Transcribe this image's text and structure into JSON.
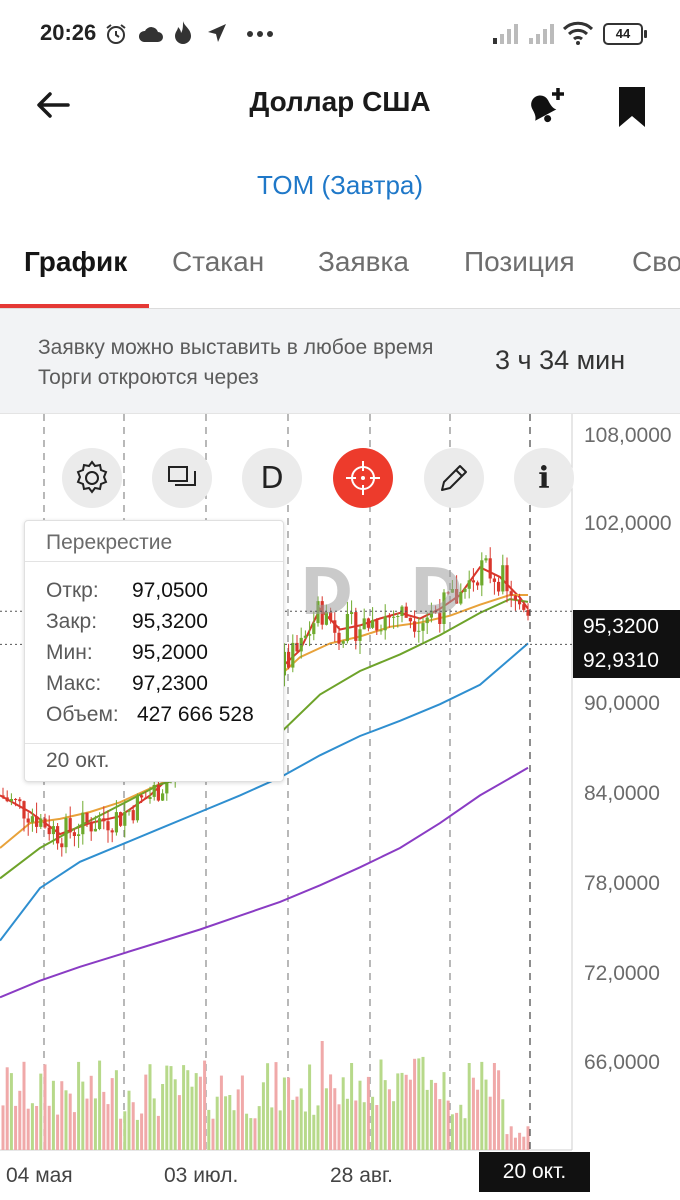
{
  "status_bar": {
    "time": "20:26",
    "battery": "44",
    "icons": [
      "alarm-icon",
      "cloud-icon",
      "fire-icon",
      "location-arrow-icon",
      "more-dots-icon",
      "signal-icon",
      "signal-icon",
      "wifi-icon",
      "battery-icon"
    ]
  },
  "header": {
    "title": "Доллар США",
    "subtitle": "TOM (Завтра)",
    "icons": [
      "back-arrow-icon",
      "bell-plus-icon",
      "bookmark-icon"
    ]
  },
  "tabs": [
    {
      "label": "График",
      "active": true
    },
    {
      "label": "Стакан",
      "active": false
    },
    {
      "label": "Заявка",
      "active": false
    },
    {
      "label": "Позиция",
      "active": false
    },
    {
      "label": "Сво",
      "active": false
    }
  ],
  "notice": {
    "text": "Заявку можно выставить в любое время Торги откроются через",
    "timer": "3 ч 34 мин"
  },
  "toolbar": {
    "buttons": [
      "gear-icon",
      "windows-icon",
      "d-letter-icon",
      "crosshair-icon",
      "pencil-icon",
      "info-icon"
    ],
    "active": "crosshair-icon",
    "d_label": "D",
    "i_label": "i"
  },
  "crosshair_panel": {
    "title": "Перекрестие",
    "rows": [
      {
        "label": "Откр:",
        "value": "97,0500"
      },
      {
        "label": "Закр:",
        "value": "95,3200"
      },
      {
        "label": "Мин:",
        "value": "95,2000"
      },
      {
        "label": "Макс:",
        "value": "97,2300"
      },
      {
        "label": "Объем:",
        "value": "427 666 528"
      }
    ],
    "date": "20 окт."
  },
  "colors": {
    "accent": "#e53935",
    "link": "#1f78c8",
    "candle_up": "#6eaa2c",
    "candle_down": "#d9362c",
    "ma_fast": "#d9362c",
    "ma_orange": "#e8a23a",
    "ma_green": "#6ea32a",
    "ma_blue": "#2f8fd0",
    "ma_purple": "#8a3cc4"
  },
  "chart_data": {
    "type": "candlestick",
    "y_ticks": [
      "108,0000",
      "102,0000",
      "90,0000",
      "84,0000",
      "78,0000",
      "72,0000",
      "66,0000"
    ],
    "ylim": [
      62.5,
      108
    ],
    "x_ticks": [
      "04 мая",
      "03 июл.",
      "28 авг."
    ],
    "selected_date": "20 окт.",
    "price_tags": [
      {
        "label": "95,3200",
        "value": 95.32
      },
      {
        "label": "92,9310",
        "value": 92.931
      }
    ],
    "moving_averages": {
      "red": [
        [
          0,
          82.0
        ],
        [
          30,
          80.8
        ],
        [
          60,
          79.2
        ],
        [
          90,
          80.0
        ],
        [
          120,
          80.5
        ],
        [
          150,
          82.0
        ],
        [
          180,
          84.0
        ],
        [
          210,
          86.0
        ],
        [
          240,
          88.5
        ],
        [
          270,
          90.5
        ],
        [
          300,
          92.5
        ],
        [
          320,
          95.5
        ],
        [
          340,
          94.0
        ],
        [
          360,
          94.3
        ],
        [
          380,
          94.8
        ],
        [
          400,
          95.2
        ],
        [
          420,
          94.8
        ],
        [
          440,
          95.5
        ],
        [
          460,
          96.5
        ],
        [
          480,
          98.5
        ],
        [
          500,
          97.8
        ],
        [
          520,
          96.3
        ],
        [
          528,
          95.5
        ]
      ],
      "orange": [
        [
          0,
          78.2
        ],
        [
          30,
          80.0
        ],
        [
          60,
          80.3
        ],
        [
          90,
          80.8
        ],
        [
          120,
          81.5
        ],
        [
          150,
          82.5
        ],
        [
          180,
          83.5
        ],
        [
          210,
          85.5
        ],
        [
          240,
          87.5
        ],
        [
          270,
          90.0
        ],
        [
          300,
          92.0
        ],
        [
          330,
          93.0
        ],
        [
          360,
          93.5
        ],
        [
          390,
          94.2
        ],
        [
          420,
          94.5
        ],
        [
          450,
          95.0
        ],
        [
          480,
          95.8
        ],
        [
          510,
          96.5
        ],
        [
          528,
          96.5
        ]
      ],
      "green": [
        [
          0,
          76.0
        ],
        [
          40,
          78.2
        ],
        [
          80,
          79.8
        ],
        [
          120,
          81.3
        ],
        [
          160,
          82.8
        ],
        [
          200,
          83.6
        ],
        [
          240,
          84.3
        ],
        [
          280,
          86.5
        ],
        [
          320,
          89.3
        ],
        [
          360,
          91.0
        ],
        [
          400,
          92.2
        ],
        [
          440,
          93.6
        ],
        [
          480,
          95.2
        ],
        [
          510,
          96.2
        ],
        [
          528,
          96.0
        ]
      ],
      "blue": [
        [
          0,
          71.5
        ],
        [
          40,
          75.3
        ],
        [
          80,
          77.2
        ],
        [
          120,
          78.4
        ],
        [
          160,
          79.6
        ],
        [
          200,
          80.8
        ],
        [
          240,
          82.0
        ],
        [
          280,
          83.3
        ],
        [
          320,
          84.9
        ],
        [
          360,
          86.3
        ],
        [
          400,
          87.4
        ],
        [
          440,
          88.6
        ],
        [
          480,
          90.0
        ],
        [
          528,
          93.0
        ]
      ],
      "purple": [
        [
          0,
          67.4
        ],
        [
          40,
          68.6
        ],
        [
          80,
          69.6
        ],
        [
          120,
          70.5
        ],
        [
          160,
          71.4
        ],
        [
          200,
          72.3
        ],
        [
          240,
          73.3
        ],
        [
          280,
          74.3
        ],
        [
          320,
          75.5
        ],
        [
          360,
          76.8
        ],
        [
          400,
          78.2
        ],
        [
          440,
          80.0
        ],
        [
          480,
          82.0
        ],
        [
          528,
          84.0
        ]
      ]
    },
    "candles_note": "daily candles, last close 95,3200"
  }
}
